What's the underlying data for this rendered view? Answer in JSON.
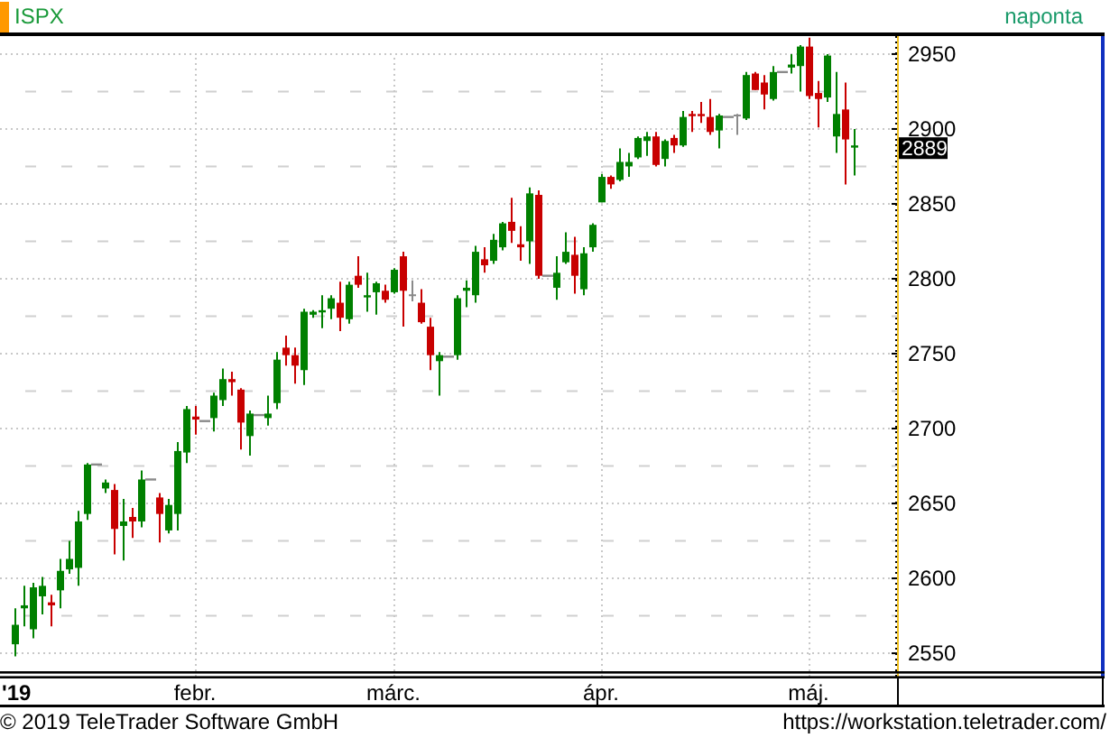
{
  "header": {
    "interval": "naponta"
  },
  "chart": {
    "last_price": "2889",
    "chart_data": {
      "type": "candlestick",
      "title": "ISPX",
      "categories": [
        "'19",
        null,
        null,
        null,
        null,
        null,
        null,
        null,
        null,
        null,
        null,
        null,
        null,
        null,
        null,
        null,
        null,
        null,
        null,
        null,
        "febr.",
        null,
        null,
        null,
        null,
        null,
        null,
        null,
        null,
        null,
        null,
        null,
        null,
        null,
        null,
        null,
        null,
        null,
        null,
        null,
        null,
        null,
        "márc.",
        null,
        null,
        null,
        null,
        null,
        null,
        null,
        null,
        null,
        null,
        null,
        null,
        null,
        null,
        null,
        null,
        null,
        null,
        null,
        null,
        null,
        null,
        "ápr.",
        null,
        null,
        null,
        null,
        null,
        null,
        null,
        null,
        null,
        null,
        null,
        null,
        null,
        null,
        null,
        null,
        null,
        null,
        null,
        null,
        null,
        null,
        "máj.",
        null,
        null,
        null,
        null,
        null
      ],
      "ylim": [
        2538,
        2962
      ],
      "grid": true,
      "yticks": [
        2550,
        2600,
        2650,
        2700,
        2750,
        2800,
        2850,
        2900,
        2950
      ],
      "ohlc": [
        [
          2556,
          2580,
          2548,
          2569
        ],
        [
          2580,
          2595,
          2568,
          2582
        ],
        [
          2566,
          2597,
          2560,
          2594
        ],
        [
          2588,
          2601,
          2576,
          2595
        ],
        [
          2584,
          2589,
          2568,
          2582
        ],
        [
          2592,
          2613,
          2580,
          2605
        ],
        [
          2606,
          2625,
          2603,
          2613
        ],
        [
          2607,
          2645,
          2595,
          2638
        ],
        [
          2643,
          2677,
          2639,
          2676
        ],
        [
          2676,
          2676,
          2676,
          2676
        ],
        [
          2660,
          2666,
          2657,
          2664
        ],
        [
          2659,
          2663,
          2616,
          2633
        ],
        [
          2635,
          2653,
          2612,
          2638
        ],
        [
          2641,
          2647,
          2627,
          2638
        ],
        [
          2638,
          2672,
          2634,
          2666
        ],
        [
          2666,
          2666,
          2666,
          2666
        ],
        [
          2654,
          2657,
          2624,
          2643
        ],
        [
          2632,
          2653,
          2630,
          2649
        ],
        [
          2643,
          2691,
          2632,
          2685
        ],
        [
          2684,
          2715,
          2677,
          2713
        ],
        [
          2708,
          2715,
          2696,
          2706
        ],
        [
          2705,
          2705,
          2705,
          2705
        ],
        [
          2707,
          2724,
          2698,
          2722
        ],
        [
          2719,
          2740,
          2715,
          2733
        ],
        [
          2733,
          2738,
          2722,
          2731
        ],
        [
          2726,
          2727,
          2686,
          2704
        ],
        [
          2695,
          2712,
          2682,
          2710
        ],
        [
          2709,
          2709,
          2709,
          2709
        ],
        [
          2707,
          2722,
          2702,
          2710
        ],
        [
          2717,
          2751,
          2713,
          2746
        ],
        [
          2754,
          2762,
          2742,
          2749
        ],
        [
          2749,
          2754,
          2730,
          2742
        ],
        [
          2739,
          2780,
          2729,
          2778
        ],
        [
          2776,
          2779,
          2774,
          2778
        ],
        [
          2778,
          2789,
          2767,
          2779
        ],
        [
          2780,
          2789,
          2773,
          2787
        ],
        [
          2784,
          2798,
          2765,
          2774
        ],
        [
          2773,
          2798,
          2770,
          2796
        ],
        [
          2802,
          2815,
          2794,
          2796
        ],
        [
          2788,
          2804,
          2778,
          2789
        ],
        [
          2791,
          2798,
          2776,
          2797
        ],
        [
          2792,
          2796,
          2784,
          2786
        ],
        [
          2791,
          2807,
          2790,
          2806
        ],
        [
          2815,
          2818,
          2768,
          2792
        ],
        [
          2789,
          2799,
          2785,
          2789
        ],
        [
          2784,
          2793,
          2770,
          2771
        ],
        [
          2768,
          2774,
          2739,
          2749
        ],
        [
          2745,
          2751,
          2722,
          2749
        ],
        [
          2748,
          2748,
          2748,
          2748
        ],
        [
          2749,
          2789,
          2746,
          2787
        ],
        [
          2792,
          2799,
          2781,
          2794
        ],
        [
          2789,
          2822,
          2784,
          2818
        ],
        [
          2813,
          2821,
          2804,
          2809
        ],
        [
          2812,
          2830,
          2810,
          2826
        ],
        [
          2821,
          2838,
          2819,
          2837
        ],
        [
          2838,
          2854,
          2824,
          2832
        ],
        [
          2823,
          2835,
          2812,
          2821
        ],
        [
          2825,
          2861,
          2810,
          2857
        ],
        [
          2856,
          2859,
          2800,
          2802
        ],
        [
          2802,
          2802,
          2802,
          2802
        ],
        [
          2794,
          2815,
          2786,
          2804
        ],
        [
          2811,
          2831,
          2810,
          2818
        ],
        [
          2816,
          2828,
          2790,
          2802
        ],
        [
          2793,
          2821,
          2789,
          2817
        ],
        [
          2821,
          2837,
          2818,
          2836
        ],
        [
          2851,
          2870,
          2851,
          2868
        ],
        [
          2868,
          2869,
          2860,
          2863
        ],
        [
          2866,
          2887,
          2865,
          2878
        ],
        [
          2875,
          2884,
          2868,
          2878
        ],
        [
          2881,
          2895,
          2880,
          2894
        ],
        [
          2892,
          2898,
          2882,
          2895
        ],
        [
          2895,
          2898,
          2875,
          2876
        ],
        [
          2880,
          2893,
          2875,
          2892
        ],
        [
          2894,
          2896,
          2884,
          2889
        ],
        [
          2889,
          2912,
          2888,
          2908
        ],
        [
          2910,
          2912,
          2898,
          2909
        ],
        [
          2910,
          2918,
          2904,
          2909
        ],
        [
          2908,
          2920,
          2896,
          2898
        ],
        [
          2899,
          2910,
          2887,
          2909
        ],
        [
          2908,
          2908,
          2908,
          2908
        ],
        [
          2909,
          2910,
          2896,
          2909
        ],
        [
          2907,
          2938,
          2906,
          2936
        ],
        [
          2937,
          2938,
          2926,
          2926
        ],
        [
          2931,
          2936,
          2913,
          2923
        ],
        [
          2920,
          2942,
          2919,
          2938
        ],
        [
          2938,
          2938,
          2938,
          2938
        ],
        [
          2941,
          2950,
          2937,
          2943
        ],
        [
          2942,
          2956,
          2925,
          2955
        ],
        [
          2955,
          2961,
          2920,
          2922
        ],
        [
          2924,
          2932,
          2901,
          2920
        ],
        [
          2921,
          2950,
          2918,
          2949
        ],
        [
          2895,
          2938,
          2884,
          2910
        ],
        [
          2913,
          2931,
          2863,
          2893
        ],
        [
          2888,
          2900,
          2869,
          2889
        ]
      ]
    }
  },
  "footer": {
    "copyright": "© 2019 TeleTrader Software GmbH",
    "url": "https://workstation.teletrader.com/"
  }
}
